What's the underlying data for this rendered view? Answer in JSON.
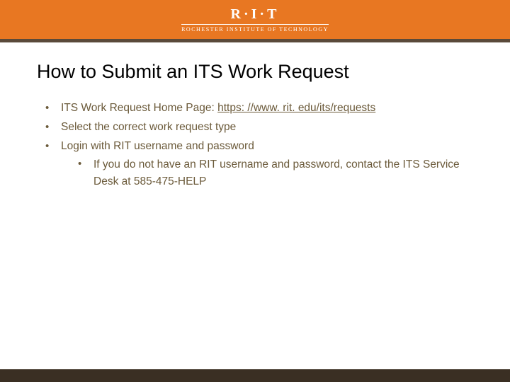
{
  "header": {
    "logo_main": "R·I·T",
    "logo_sub": "ROCHESTER INSTITUTE OF TECHNOLOGY"
  },
  "title": "How to Submit an ITS Work Request",
  "bullets": {
    "b1_prefix": "ITS Work Request Home Page: ",
    "b1_link": "https: //www. rit. edu/its/requests",
    "b2": "Select the correct work request type",
    "b3": "Login with RIT username and password",
    "b3_sub": "If you do not have an RIT username and password, contact the ITS Service Desk at 585-475-HELP"
  }
}
